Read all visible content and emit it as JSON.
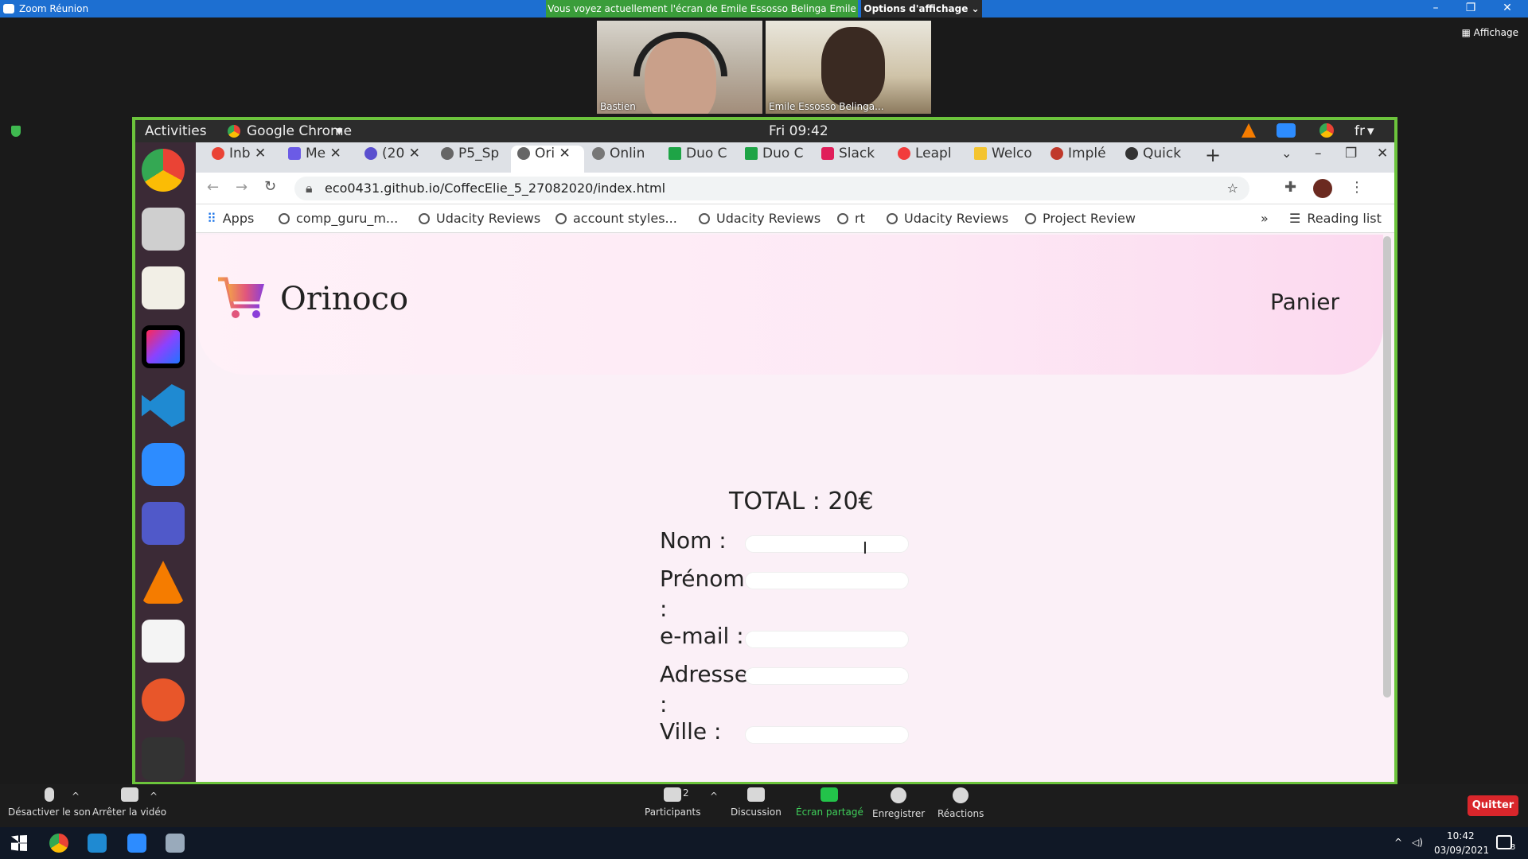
{
  "zoom": {
    "title": "Zoom Réunion",
    "banner": "Vous voyez actuellement l'écran de Emile Essosso Belinga Emile",
    "view_options": "Options d'affichage ⌄",
    "affichage": "Affichage",
    "participants": [
      {
        "name": "Bastien"
      },
      {
        "name": "Emile Essosso Belinga..."
      }
    ],
    "toolbar": {
      "mute": "Désactiver le son",
      "video": "Arrêter la vidéo",
      "participants": "Participants",
      "participants_count": "2",
      "chat": "Discussion",
      "share": "Écran partagé",
      "record": "Enregistrer",
      "reactions": "Réactions",
      "quit": "Quitter"
    }
  },
  "ubuntu": {
    "activities": "Activities",
    "app": "Google Chrome",
    "clock": "Fri 09:42",
    "lang": "fr"
  },
  "chrome": {
    "tabs": [
      "Inb",
      "Me",
      "(20",
      "P5_Sp",
      "Ori",
      "Onlin",
      "Duo C",
      "Duo C",
      "Slack",
      "Leapl",
      "Welco",
      "Implé",
      "Quick"
    ],
    "url": "eco0431.github.io/CoffecElie_5_27082020/index.html",
    "bookmarks": [
      "Apps",
      "comp_guru_m...",
      "Udacity Reviews",
      "account styles...",
      "Udacity Reviews",
      "rt",
      "Udacity Reviews",
      "Project Review"
    ],
    "more": "»",
    "reading_list": "Reading list"
  },
  "page": {
    "brand": "Orinoco",
    "cart": "Panier",
    "total": "TOTAL : 20€",
    "fields": [
      "Nom :",
      "Prénom :",
      "e-mail :",
      "Adresse :",
      "Ville :"
    ]
  },
  "taskbar": {
    "time": "10:42",
    "date": "03/09/2021",
    "notif": "3"
  }
}
